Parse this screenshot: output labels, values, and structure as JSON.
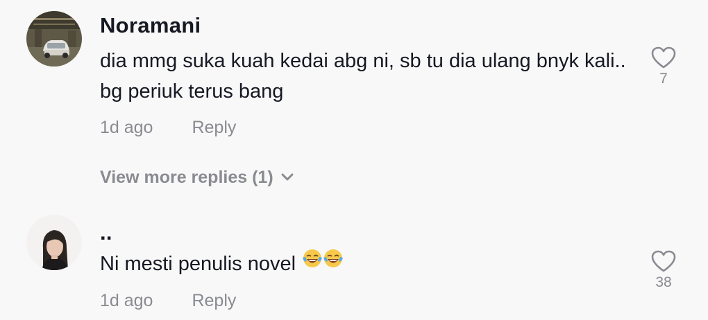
{
  "comments": [
    {
      "username": "Noramani",
      "text": "dia mmg suka kuah kedai abg ni, sb tu dia ulang bnyk kali.. bg periuk terus bang",
      "time": "1d ago",
      "reply_label": "Reply",
      "likes": "7",
      "avatar_icon": "parking-garage-car-photo"
    },
    {
      "username": "..",
      "text": "Ni mesti penulis novel",
      "text_emoji": [
        "face-with-tears-of-joy",
        "face-with-tears-of-joy"
      ],
      "time": "1d ago",
      "reply_label": "Reply",
      "likes": "38",
      "avatar_icon": "woman-portrait-photo"
    }
  ],
  "view_more": {
    "label": "View more replies (1)",
    "icon": "chevron-down-icon"
  },
  "colors": {
    "background": "#f8f8f8",
    "text_primary": "#161823",
    "text_secondary": "#8a8b91"
  }
}
